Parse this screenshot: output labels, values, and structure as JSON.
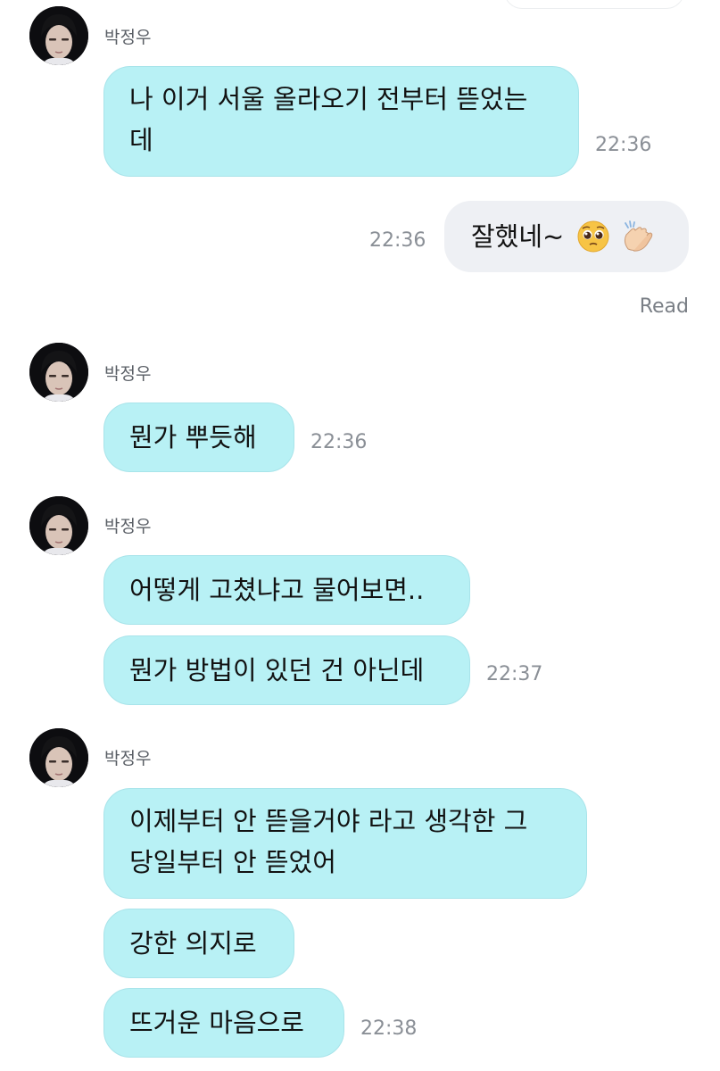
{
  "chat": {
    "groups": [
      {
        "sender": "박정우",
        "messages": [
          {
            "line1": "나 이거 서울 올라오기 전부터 뜯었는",
            "line2": "데"
          }
        ],
        "time": "22:36"
      },
      {
        "sender": "박정우",
        "messages": [
          {
            "text": "뭔가 뿌듯해"
          }
        ],
        "time": "22:36"
      },
      {
        "sender": "박정우",
        "messages": [
          {
            "text": "어떻게 고쳤냐고 물어보면.."
          },
          {
            "text": "뭔가 방법이 있던 건 아닌데"
          }
        ],
        "time": "22:37"
      },
      {
        "sender": "박정우",
        "messages": [
          {
            "line1": "이제부터 안 뜯을거야 라고 생각한 그",
            "line2": "당일부터 안 뜯었어"
          },
          {
            "text": "강한 의지로"
          },
          {
            "text": "뜨거운 마음으로"
          }
        ],
        "time": "22:38"
      }
    ],
    "outgoing": {
      "text": "잘했네~",
      "emojis": [
        "pleading-face-icon",
        "clapping-hands-icon"
      ],
      "time": "22:36",
      "status": "Read"
    }
  },
  "colors": {
    "incoming_bubble": "#b8f1f5",
    "outgoing_bubble": "#eef0f4",
    "timestamp": "#8a8f96"
  }
}
